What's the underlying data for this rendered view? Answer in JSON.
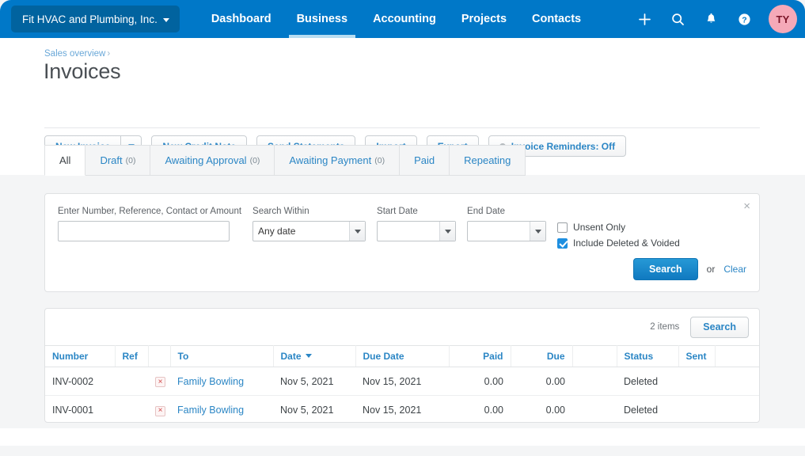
{
  "navbar": {
    "org_name": "Fit HVAC and Plumbing, Inc.",
    "links": [
      {
        "label": "Dashboard",
        "active": false
      },
      {
        "label": "Business",
        "active": true
      },
      {
        "label": "Accounting",
        "active": false
      },
      {
        "label": "Projects",
        "active": false
      },
      {
        "label": "Contacts",
        "active": false
      }
    ],
    "icons": [
      "plus-icon",
      "search-icon",
      "bell-icon",
      "help-icon"
    ],
    "avatar_initials": "TY",
    "brand_color": "#0078c8",
    "org_pill_color": "#01639f",
    "avatar_bg": "#f5a9b8"
  },
  "header": {
    "breadcrumb": "Sales overview",
    "breadcrumb_sep": "›",
    "title": "Invoices"
  },
  "actions": {
    "new_invoice": "New Invoice",
    "new_credit_note": "New Credit Note",
    "send_statements": "Send Statements",
    "import": "Import",
    "export": "Export",
    "invoice_reminders": "Invoice Reminders: Off"
  },
  "tabs": [
    {
      "label": "All",
      "count": "",
      "active": true
    },
    {
      "label": "Draft",
      "count": "(0)",
      "active": false
    },
    {
      "label": "Awaiting Approval",
      "count": "(0)",
      "active": false
    },
    {
      "label": "Awaiting Payment",
      "count": "(0)",
      "active": false
    },
    {
      "label": "Paid",
      "count": "",
      "active": false
    },
    {
      "label": "Repeating",
      "count": "",
      "active": false
    }
  ],
  "search_panel": {
    "query_label": "Enter Number, Reference, Contact or Amount",
    "query_value": "",
    "query_placeholder": "",
    "search_within_label": "Search Within",
    "search_within_value": "Any date",
    "start_date_label": "Start Date",
    "start_date_value": "",
    "end_date_label": "End Date",
    "end_date_value": "",
    "unsent_only_label": "Unsent Only",
    "unsent_only_checked": false,
    "include_deleted_label": "Include Deleted & Voided",
    "include_deleted_checked": true,
    "search_button": "Search",
    "or_text": "or",
    "clear_link": "Clear",
    "close_icon": "×"
  },
  "results": {
    "items_count": "2 items",
    "search_button": "Search",
    "columns": [
      "Number",
      "Ref",
      "",
      "To",
      "Date",
      "Due Date",
      "Paid",
      "Due",
      "",
      "Status",
      "Sent",
      ""
    ],
    "sorted_column": "Date",
    "rows": [
      {
        "number": "INV-0002",
        "ref": "",
        "flag": "×",
        "to": "Family Bowling",
        "date": "Nov 5, 2021",
        "due_date": "Nov 15, 2021",
        "paid": "0.00",
        "due": "0.00",
        "extra": "",
        "status": "Deleted",
        "sent": "",
        "last": ""
      },
      {
        "number": "INV-0001",
        "ref": "",
        "flag": "×",
        "to": "Family Bowling",
        "date": "Nov 5, 2021",
        "due_date": "Nov 15, 2021",
        "paid": "0.00",
        "due": "0.00",
        "extra": "",
        "status": "Deleted",
        "sent": "",
        "last": ""
      }
    ]
  }
}
